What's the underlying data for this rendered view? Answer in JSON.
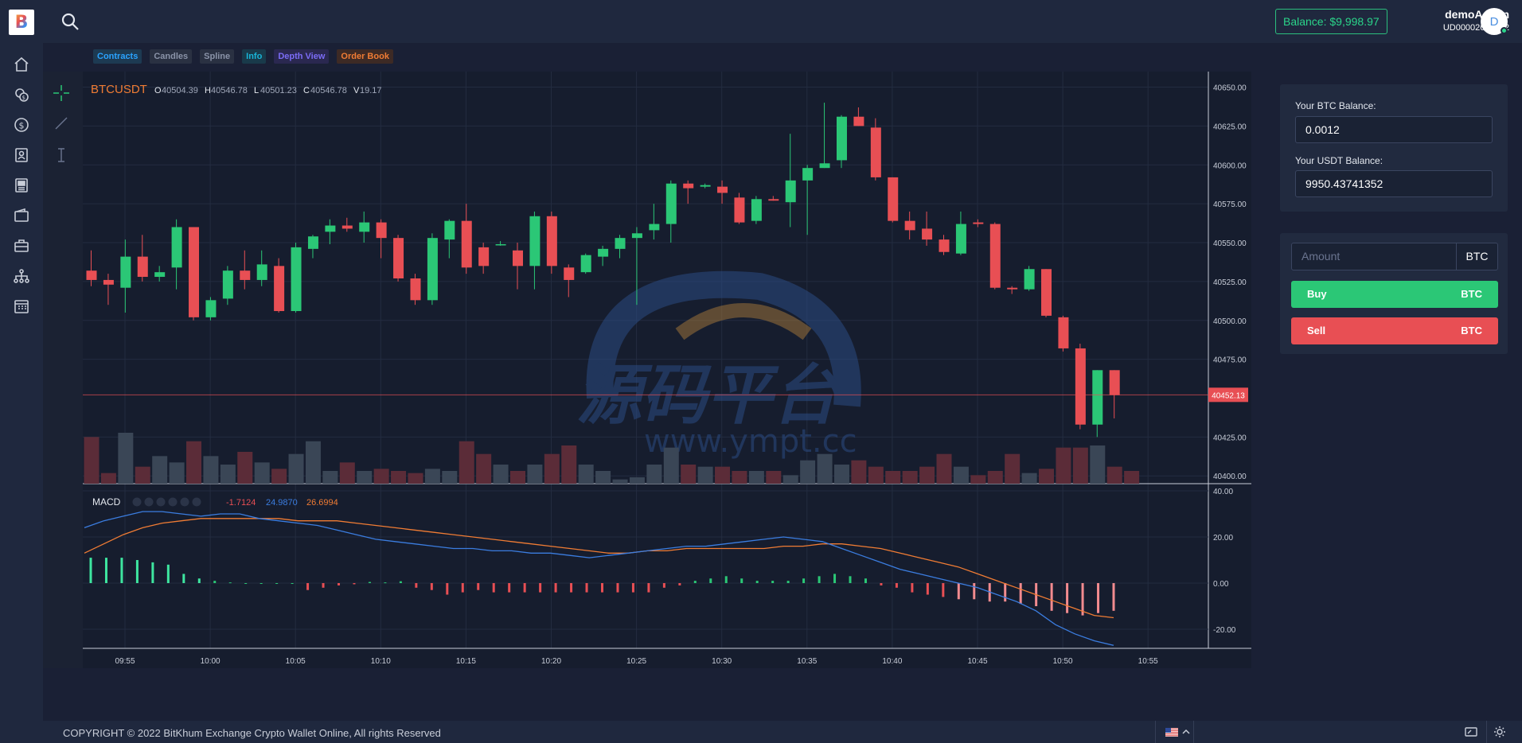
{
  "app": {
    "logo_letter": "B"
  },
  "sidebar": {
    "items": [
      {
        "icon": "home-icon"
      },
      {
        "icon": "coins-icon"
      },
      {
        "icon": "dollar-circle-icon"
      },
      {
        "icon": "contacts-icon"
      },
      {
        "icon": "news-icon"
      },
      {
        "icon": "wallet-icon"
      },
      {
        "icon": "briefcase-icon"
      },
      {
        "icon": "sitemap-icon"
      },
      {
        "icon": "calendar-icon"
      }
    ]
  },
  "header": {
    "balance": "Balance: $9,998.97",
    "username": "demoAdmin",
    "user_id": "UD00002659512",
    "avatar_letter": "D"
  },
  "tabs": [
    {
      "label": "Contracts",
      "color": "#2aa3ff",
      "bg": "#1d3a52"
    },
    {
      "label": "Candles",
      "color": "#8a93a8",
      "bg": "#2a3142"
    },
    {
      "label": "Spline",
      "color": "#8a93a8",
      "bg": "#2a3142"
    },
    {
      "label": "Info",
      "color": "#19b5d8",
      "bg": "#193a4a"
    },
    {
      "label": "Depth View",
      "color": "#7b6cf6",
      "bg": "#2a2850"
    },
    {
      "label": "Order Book",
      "color": "#f07c34",
      "bg": "#3d2a25"
    }
  ],
  "chart_data": {
    "type": "candlestick",
    "symbol": "BTCUSDT",
    "ohlcv": {
      "O": "40504.39",
      "H": "40546.78",
      "L": "40501.23",
      "C": "40546.78",
      "V": "19.17"
    },
    "last_price": "40452.13",
    "y_ticks": [
      "40650.00",
      "40625.00",
      "40600.00",
      "40575.00",
      "40550.00",
      "40525.00",
      "40500.00",
      "40475.00",
      "40425.00",
      "40400.00"
    ],
    "x_ticks": [
      "09:55",
      "10:00",
      "10:05",
      "10:10",
      "10:15",
      "10:20",
      "10:25",
      "10:30",
      "10:35",
      "10:40",
      "10:45",
      "10:50",
      "10:55"
    ],
    "ylim": [
      40395,
      40660
    ],
    "candles": [
      {
        "t": 0,
        "o": 40532,
        "h": 40545,
        "l": 40522,
        "c": 40526
      },
      {
        "t": 1,
        "o": 40526,
        "h": 40530,
        "l": 40510,
        "c": 40523
      },
      {
        "t": 2,
        "o": 40521,
        "h": 40552,
        "l": 40505,
        "c": 40541
      },
      {
        "t": 3,
        "o": 40541,
        "h": 40555,
        "l": 40525,
        "c": 40528
      },
      {
        "t": 4,
        "o": 40528,
        "h": 40535,
        "l": 40525,
        "c": 40531
      },
      {
        "t": 5,
        "o": 40534,
        "h": 40565,
        "l": 40520,
        "c": 40560
      },
      {
        "t": 6,
        "o": 40560,
        "h": 40560,
        "l": 40500,
        "c": 40502
      },
      {
        "t": 7,
        "o": 40502,
        "h": 40515,
        "l": 40500,
        "c": 40513
      },
      {
        "t": 8,
        "o": 40514,
        "h": 40535,
        "l": 40510,
        "c": 40532
      },
      {
        "t": 9,
        "o": 40532,
        "h": 40545,
        "l": 40520,
        "c": 40526
      },
      {
        "t": 10,
        "o": 40526,
        "h": 40545,
        "l": 40522,
        "c": 40536
      },
      {
        "t": 11,
        "o": 40535,
        "h": 40540,
        "l": 40505,
        "c": 40506
      },
      {
        "t": 12,
        "o": 40506,
        "h": 40550,
        "l": 40505,
        "c": 40547
      },
      {
        "t": 13,
        "o": 40546,
        "h": 40555,
        "l": 40540,
        "c": 40554
      },
      {
        "t": 14,
        "o": 40557,
        "h": 40565,
        "l": 40549,
        "c": 40561
      },
      {
        "t": 15,
        "o": 40561,
        "h": 40566,
        "l": 40557,
        "c": 40559
      },
      {
        "t": 16,
        "o": 40557,
        "h": 40570,
        "l": 40550,
        "c": 40563
      },
      {
        "t": 17,
        "o": 40563,
        "h": 40565,
        "l": 40540,
        "c": 40553
      },
      {
        "t": 18,
        "o": 40553,
        "h": 40555,
        "l": 40525,
        "c": 40527
      },
      {
        "t": 19,
        "o": 40527,
        "h": 40530,
        "l": 40510,
        "c": 40513
      },
      {
        "t": 20,
        "o": 40513,
        "h": 40556,
        "l": 40510,
        "c": 40553
      },
      {
        "t": 21,
        "o": 40552,
        "h": 40565,
        "l": 40540,
        "c": 40564
      },
      {
        "t": 22,
        "o": 40564,
        "h": 40575,
        "l": 40530,
        "c": 40534
      },
      {
        "t": 23,
        "o": 40547,
        "h": 40550,
        "l": 40530,
        "c": 40535
      },
      {
        "t": 24,
        "o": 40549,
        "h": 40551,
        "l": 40548,
        "c": 40549
      },
      {
        "t": 25,
        "o": 40545,
        "h": 40550,
        "l": 40520,
        "c": 40535
      },
      {
        "t": 26,
        "o": 40535,
        "h": 40570,
        "l": 40520,
        "c": 40567
      },
      {
        "t": 27,
        "o": 40567,
        "h": 40570,
        "l": 40530,
        "c": 40535
      },
      {
        "t": 28,
        "o": 40534,
        "h": 40536,
        "l": 40515,
        "c": 40526
      },
      {
        "t": 29,
        "o": 40531,
        "h": 40543,
        "l": 40530,
        "c": 40542
      },
      {
        "t": 30,
        "o": 40541,
        "h": 40548,
        "l": 40535,
        "c": 40546
      },
      {
        "t": 31,
        "o": 40546,
        "h": 40555,
        "l": 40540,
        "c": 40553
      },
      {
        "t": 32,
        "o": 40553,
        "h": 40560,
        "l": 40510,
        "c": 40556
      },
      {
        "t": 33,
        "o": 40558,
        "h": 40575,
        "l": 40552,
        "c": 40562
      },
      {
        "t": 34,
        "o": 40562,
        "h": 40590,
        "l": 40550,
        "c": 40588
      },
      {
        "t": 35,
        "o": 40588,
        "h": 40590,
        "l": 40575,
        "c": 40585
      },
      {
        "t": 36,
        "o": 40586,
        "h": 40588,
        "l": 40585,
        "c": 40587
      },
      {
        "t": 37,
        "o": 40586,
        "h": 40590,
        "l": 40575,
        "c": 40582
      },
      {
        "t": 38,
        "o": 40579,
        "h": 40582,
        "l": 40562,
        "c": 40563
      },
      {
        "t": 39,
        "o": 40564,
        "h": 40580,
        "l": 40562,
        "c": 40578
      },
      {
        "t": 40,
        "o": 40578,
        "h": 40580,
        "l": 40577,
        "c": 40577
      },
      {
        "t": 41,
        "o": 40576,
        "h": 40620,
        "l": 40560,
        "c": 40590
      },
      {
        "t": 42,
        "o": 40590,
        "h": 40600,
        "l": 40555,
        "c": 40598
      },
      {
        "t": 43,
        "o": 40598,
        "h": 40640,
        "l": 40598,
        "c": 40601
      },
      {
        "t": 44,
        "o": 40603,
        "h": 40632,
        "l": 40598,
        "c": 40631
      },
      {
        "t": 45,
        "o": 40631,
        "h": 40637,
        "l": 40625,
        "c": 40625
      },
      {
        "t": 46,
        "o": 40624,
        "h": 40630,
        "l": 40590,
        "c": 40592
      },
      {
        "t": 47,
        "o": 40592,
        "h": 40592,
        "l": 40563,
        "c": 40564
      },
      {
        "t": 48,
        "o": 40564,
        "h": 40570,
        "l": 40552,
        "c": 40558
      },
      {
        "t": 49,
        "o": 40559,
        "h": 40570,
        "l": 40548,
        "c": 40552
      },
      {
        "t": 50,
        "o": 40552,
        "h": 40555,
        "l": 40542,
        "c": 40544
      },
      {
        "t": 51,
        "o": 40543,
        "h": 40570,
        "l": 40542,
        "c": 40562
      },
      {
        "t": 52,
        "o": 40563,
        "h": 40565,
        "l": 40560,
        "c": 40562
      },
      {
        "t": 53,
        "o": 40562,
        "h": 40563,
        "l": 40520,
        "c": 40521
      },
      {
        "t": 54,
        "o": 40521,
        "h": 40522,
        "l": 40517,
        "c": 40520
      },
      {
        "t": 55,
        "o": 40520,
        "h": 40535,
        "l": 40519,
        "c": 40533
      },
      {
        "t": 56,
        "o": 40533,
        "h": 40533,
        "l": 40502,
        "c": 40503
      },
      {
        "t": 57,
        "o": 40502,
        "h": 40503,
        "l": 40480,
        "c": 40482
      },
      {
        "t": 58,
        "o": 40482,
        "h": 40485,
        "l": 40430,
        "c": 40433
      },
      {
        "t": 59,
        "o": 40433,
        "h": 40468,
        "l": 40425,
        "c": 40468
      },
      {
        "t": 60,
        "o": 40468,
        "h": 40468,
        "l": 40437,
        "c": 40452
      }
    ],
    "volumes": [
      22,
      5,
      24,
      8,
      13,
      10,
      20,
      13,
      9,
      15,
      10,
      7,
      14,
      20,
      6,
      10,
      6,
      7,
      6,
      5,
      7,
      6,
      20,
      14,
      9,
      6,
      9,
      14,
      18,
      9,
      6,
      2,
      3,
      9,
      17,
      9,
      8,
      8,
      6,
      6,
      6,
      4,
      11,
      14,
      9,
      11,
      8,
      6,
      6,
      8,
      14,
      8,
      4,
      6,
      14,
      5,
      7,
      17,
      17,
      18,
      8,
      6
    ],
    "macd": {
      "label": "MACD",
      "values": {
        "hist": "-1.7124",
        "macd": "24.9870",
        "signal": "26.6994"
      },
      "yticks": [
        "40.00",
        "20.00",
        "0.00",
        "-20.00"
      ],
      "ylim": [
        -30,
        40
      ],
      "hist": [
        11,
        11,
        11,
        10,
        9,
        8,
        4,
        2,
        1,
        0.3,
        0,
        0,
        0,
        0,
        -3,
        -2,
        -1,
        -0.5,
        0.5,
        0.3,
        0.8,
        -2,
        -3,
        -5,
        -4,
        -3,
        -4,
        -4,
        -4,
        -4,
        -4,
        -4,
        -4,
        -4,
        -4,
        -4,
        -4,
        -2,
        -1,
        1,
        2,
        3,
        2,
        1,
        1,
        1,
        2,
        3,
        4,
        3,
        2,
        -1,
        -2,
        -4,
        -5,
        -6,
        -7,
        -7,
        -8,
        -8,
        -9,
        -10,
        -12,
        -13,
        -14,
        -13,
        -12
      ],
      "macd_line": [
        24,
        27,
        29,
        31,
        31,
        30,
        29,
        30,
        30,
        28,
        27,
        26,
        25,
        23,
        21,
        19,
        18,
        17,
        16,
        15,
        15,
        14,
        14,
        13,
        13,
        12,
        11,
        12,
        13,
        14,
        15,
        16,
        16,
        17,
        18,
        19,
        20,
        19,
        18,
        15,
        12,
        9,
        6,
        4,
        2,
        0,
        -2,
        -5,
        -8,
        -12,
        -18,
        -22,
        -25,
        -27
      ],
      "signal_line": [
        13,
        17,
        21,
        24,
        26,
        27,
        28,
        28,
        28,
        28,
        28,
        27,
        27,
        27,
        26,
        25,
        24,
        23,
        22,
        21,
        20,
        19,
        18,
        17,
        16,
        15,
        14,
        13,
        13,
        14,
        14,
        15,
        15,
        15,
        15,
        15,
        16,
        16,
        17,
        17,
        16,
        15,
        13,
        11,
        9,
        7,
        4,
        1,
        -2,
        -5,
        -8,
        -11,
        -14,
        -15
      ]
    }
  },
  "trade": {
    "btc_balance_label": "Your BTC Balance:",
    "btc_balance": "0.0012",
    "usdt_balance_label": "Your USDT Balance:",
    "usdt_balance": "9950.43741352",
    "amount_placeholder": "Amount",
    "amount_unit": "BTC",
    "buy_label": "Buy",
    "buy_unit": "BTC",
    "sell_label": "Sell",
    "sell_unit": "BTC",
    "buy_color": "#2bc776",
    "sell_color": "#e84f54"
  },
  "watermark": {
    "cn": "源码平台",
    "url": "www.ympt.cc"
  },
  "footer": {
    "copyright": "COPYRIGHT © 2022 BitKhum Exchange Crypto Wallet Online, All rights Reserved"
  }
}
